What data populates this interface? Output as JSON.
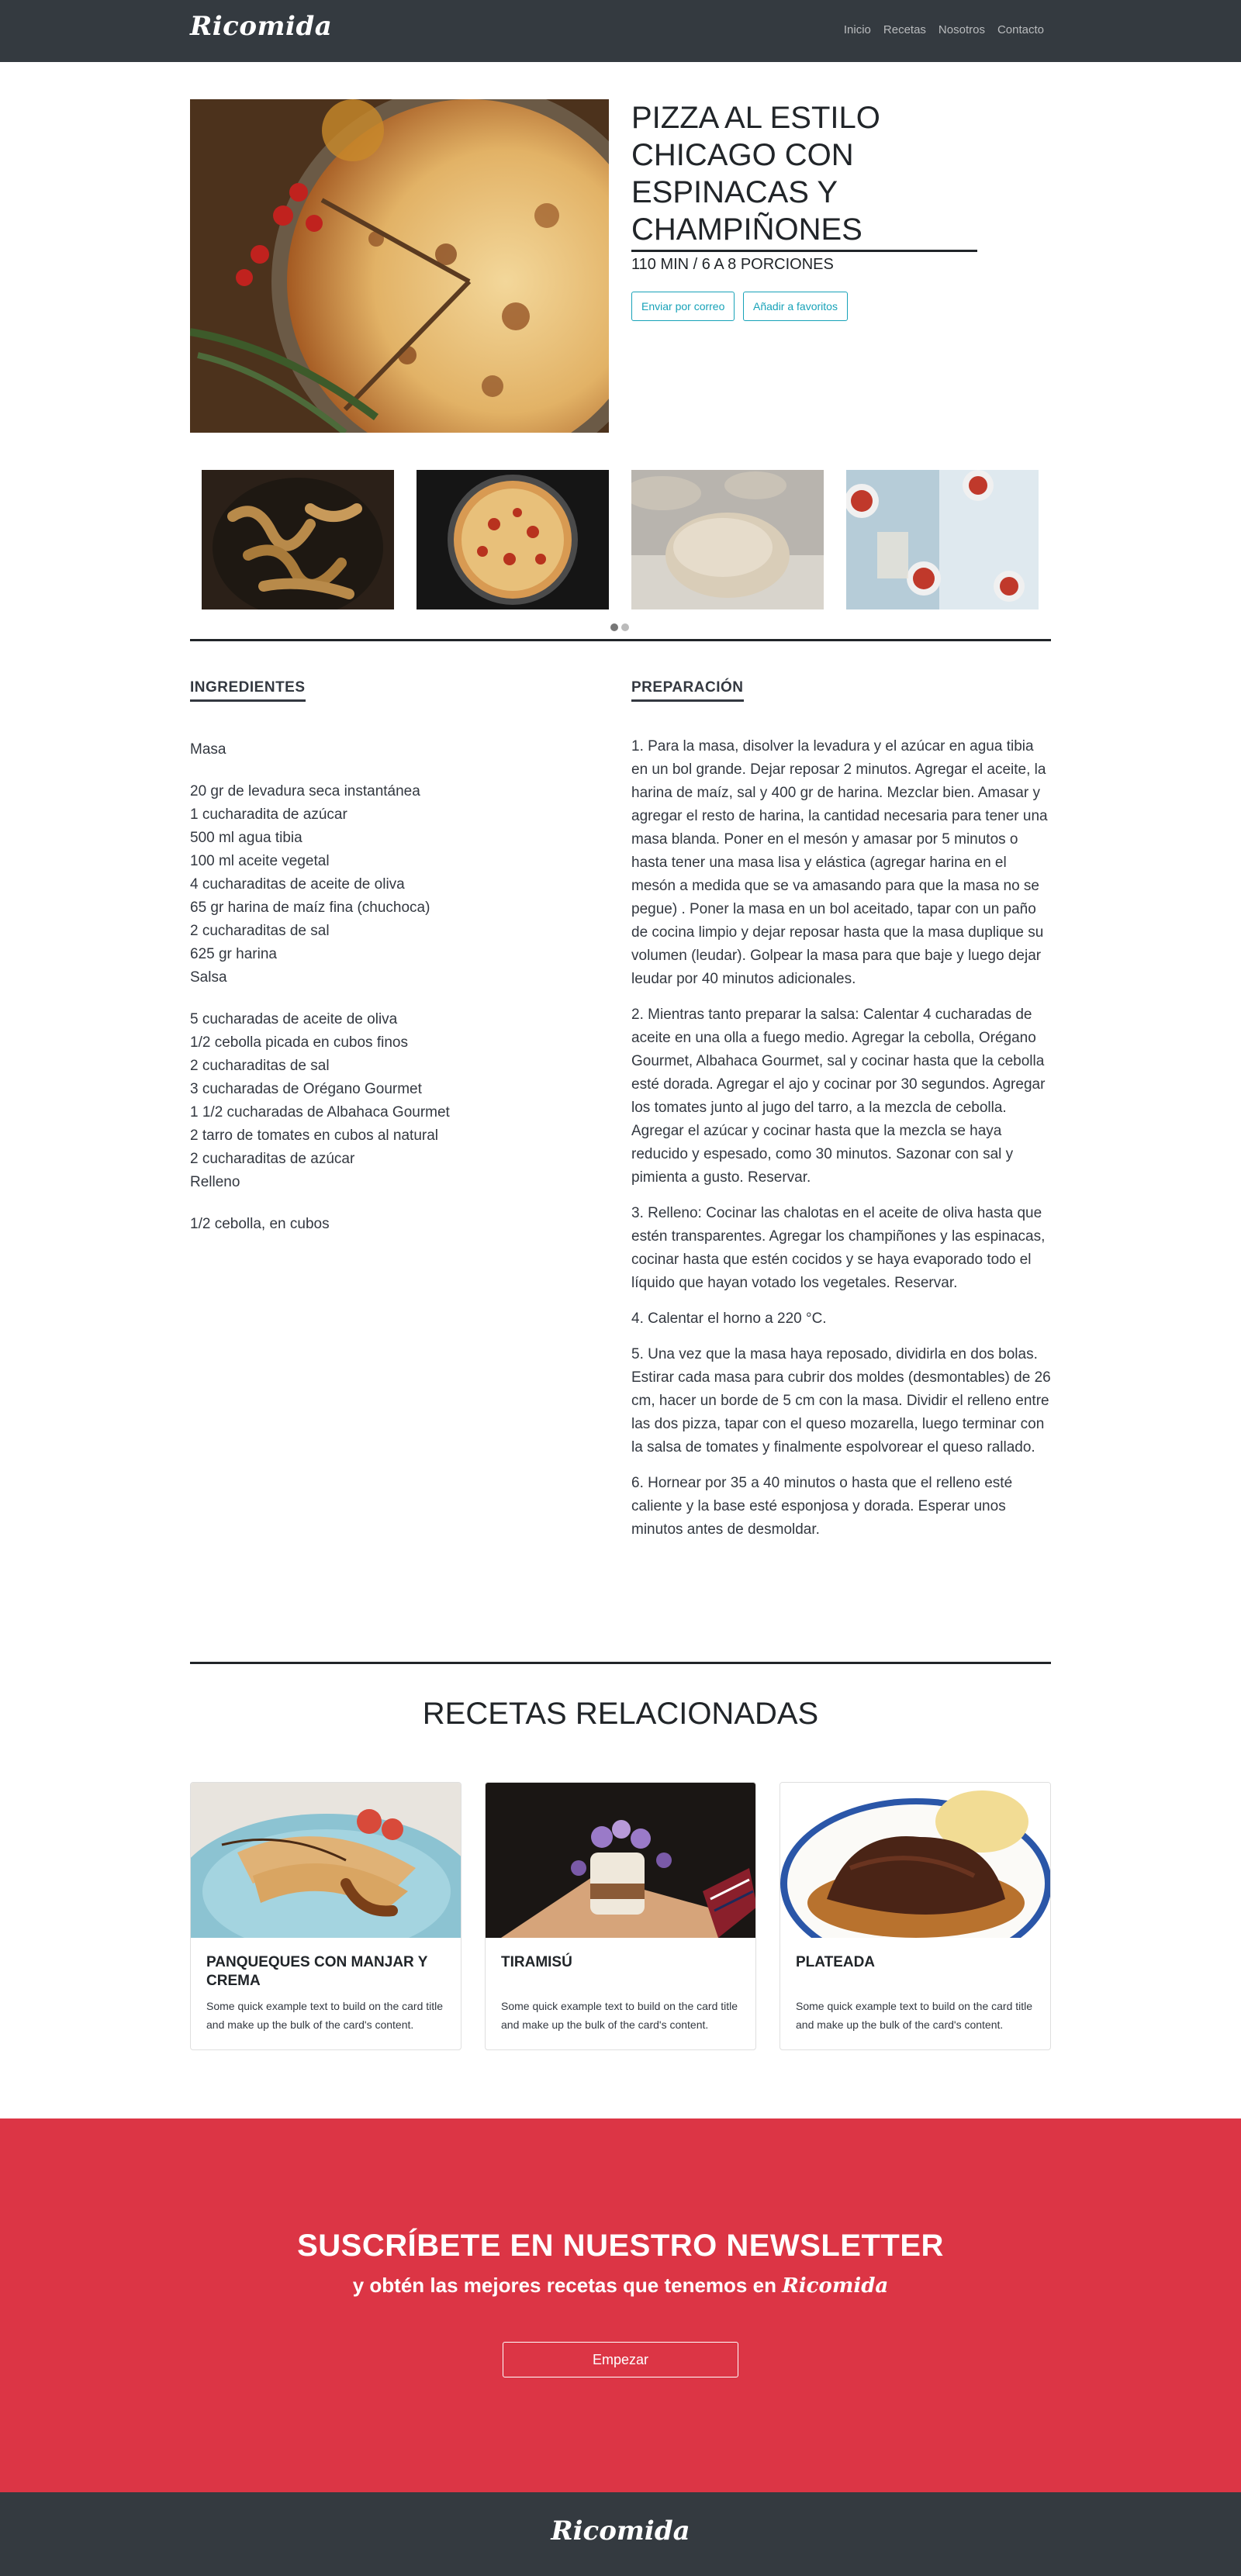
{
  "navbar": {
    "brand": "Ricomida",
    "links": [
      "Inicio",
      "Recetas",
      "Nosotros",
      "Contacto"
    ]
  },
  "recipe": {
    "title": "PIZZA AL ESTILO CHICAGO CON ESPINACAS Y CHAMPIÑONES",
    "meta": "110 MIN / 6 A 8 PORCIONES",
    "email_button": "Enviar por correo",
    "favorite_button": "Añadir a favoritos"
  },
  "ingredients": {
    "heading": "INGREDIENTES",
    "groups": [
      {
        "lines": [
          "Masa"
        ]
      },
      {
        "lines": [
          "20 gr de levadura seca instantánea",
          "1 cucharadita de azúcar",
          "500 ml agua tibia",
          "100 ml aceite vegetal",
          "4 cucharaditas de aceite de oliva",
          "65 gr harina de maíz fina (chuchoca)",
          "2 cucharaditas de sal",
          "625 gr harina",
          "Salsa"
        ]
      },
      {
        "lines": [
          "5 cucharadas de aceite de oliva",
          "1/2 cebolla picada en cubos finos",
          "2 cucharaditas de sal",
          "3 cucharadas de Orégano Gourmet",
          "1 1/2 cucharadas de Albahaca Gourmet",
          "2 tarro de tomates en cubos al natural",
          "2 cucharaditas de azúcar",
          "Relleno"
        ]
      },
      {
        "lines": [
          "1/2 cebolla, en cubos"
        ]
      }
    ]
  },
  "preparation": {
    "heading": "PREPARACIÓN",
    "steps": [
      "1. Para la masa, disolver la levadura y el azúcar en agua tibia en un bol grande. Dejar reposar 2 minutos. Agregar el aceite, la harina de maíz, sal y 400 gr de harina. Mezclar bien. Amasar y agregar el resto de harina, la cantidad necesaria para tener una masa blanda. Poner en el mesón y amasar por 5 minutos o hasta tener una masa lisa y elástica (agregar harina en el mesón a medida que se va amasando para que la masa no se pegue) . Poner la masa en un bol aceitado, tapar con un paño de cocina limpio y dejar reposar hasta que la masa duplique su volumen (leudar). Golpear la masa para que baje y luego dejar leudar por 40 minutos adicionales.",
      "2. Mientras tanto preparar la salsa: Calentar 4 cucharadas de aceite en una olla a fuego medio. Agregar la cebolla, Orégano Gourmet, Albahaca Gourmet, sal y cocinar hasta que la cebolla esté dorada. Agregar el ajo y cocinar por 30 segundos. Agregar los tomates junto al jugo del tarro, a la mezcla de cebolla. Agregar el azúcar y cocinar hasta que la mezcla se haya reducido y espesado, como 30 minutos. Sazonar con sal y pimienta a gusto. Reservar.",
      "3. Relleno: Cocinar las chalotas en el aceite de oliva hasta que estén transparentes. Agregar los champiñones y las espinacas, cocinar hasta que estén cocidos y se haya evaporado todo el líquido que hayan votado los vegetales. Reservar.",
      "4. Calentar el horno a 220 °C.",
      "5. Una vez que la masa haya reposado, dividirla en dos bolas. Estirar cada masa para cubrir dos moldes (desmontables) de 26 cm, hacer un borde de 5 cm con la masa. Dividir el relleno entre las dos pizza, tapar con el queso mozarella, luego terminar con la salsa de tomates y finalmente espolvorear el queso rallado.",
      "6. Hornear por 35 a 40 minutos o hasta que el relleno esté caliente y la base esté esponjosa y dorada. Esperar unos minutos antes de desmoldar."
    ]
  },
  "related": {
    "title": "RECETAS RELACIONADAS",
    "cards": [
      {
        "title": "PANQUEQUES CON MANJAR Y CREMA",
        "text": "Some quick example text to build on the card title and make up the bulk of the card's content."
      },
      {
        "title": "TIRAMISÚ",
        "text": "Some quick example text to build on the card title and make up the bulk of the card's content."
      },
      {
        "title": "PLATEADA",
        "text": "Some quick example text to build on the card title and make up the bulk of the card's content."
      }
    ]
  },
  "newsletter": {
    "title": "SUSCRÍBETE EN NUESTRO NEWSLETTER",
    "subtitle": "y obtén las mejores recetas que tenemos en",
    "brand": "Ricomida",
    "button": "Empezar"
  },
  "footer": {
    "brand": "Ricomida"
  },
  "colors": {
    "navbar": "#343a40",
    "accent": "#17a2b8",
    "newsletter": "#dc3545"
  }
}
